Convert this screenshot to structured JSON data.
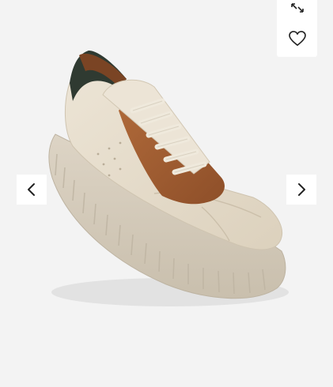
{
  "gallery": {
    "image_subject": "sneaker",
    "background_color": "#f3f3f3",
    "controls": {
      "expand_icon": "expand-icon",
      "favorite_icon": "heart-icon",
      "prev_icon": "chevron-left-icon",
      "next_icon": "chevron-right-icon"
    }
  },
  "colors": {
    "panel": "#ffffff",
    "icon": "#222222",
    "shoe_upper": "#e6dccb",
    "suede": "#a25e32",
    "collar": "#2f3a31",
    "sole": "#d8cfbf"
  }
}
